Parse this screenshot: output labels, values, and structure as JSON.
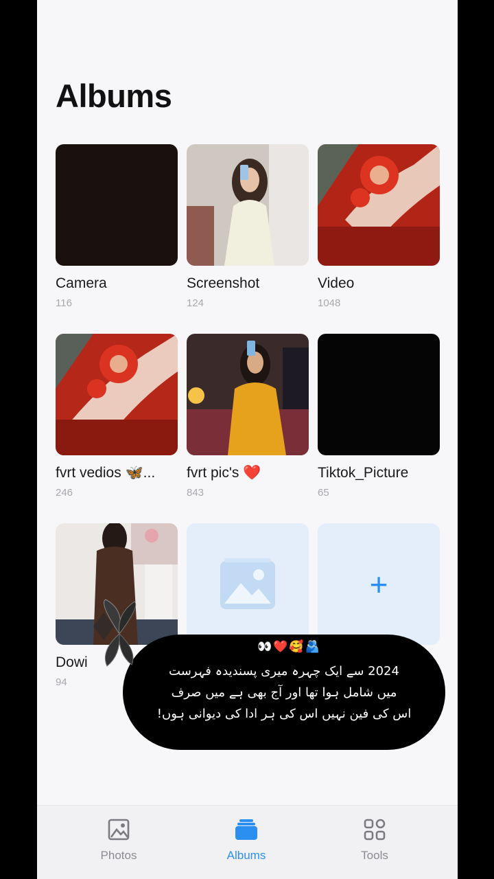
{
  "page": {
    "title": "Albums"
  },
  "albums": [
    {
      "name": "Camera",
      "count": "116",
      "thumb": "dark"
    },
    {
      "name": "Screenshot",
      "count": "124",
      "thumb": "photo-woman-white"
    },
    {
      "name": "Video",
      "count": "1048",
      "thumb": "photo-red-henna"
    },
    {
      "name": "fvrt vedios 🦋...",
      "count": "246",
      "thumb": "photo-red-henna"
    },
    {
      "name": "fvrt pic's ❤️",
      "count": "843",
      "thumb": "photo-woman-yellow"
    },
    {
      "name": "Tiktok_Picture",
      "count": "65",
      "thumb": "black"
    },
    {
      "name": "Dowi",
      "count": "94",
      "thumb": "photo-woman-brown"
    },
    {
      "name": "",
      "count": "",
      "thumb": "placeholder-image-icon"
    },
    {
      "name": "",
      "count": "",
      "thumb": "add-icon"
    }
  ],
  "add_album": {
    "symbol": "+"
  },
  "overlay": {
    "emoji": "👀❤️🥰🫂",
    "lines": [
      "2024 سے ایک چہرہ میری پسندیدہ فہرست",
      "میں شامل ہوا تھا اور آج بھی ہے میں صرف",
      "اس کی فین نہیں اس کی ہر ادا کی دیوانی ہوں!"
    ]
  },
  "bottom_nav": {
    "items": [
      {
        "label": "Photos",
        "icon": "photos-icon",
        "active": false
      },
      {
        "label": "Albums",
        "icon": "albums-icon",
        "active": true
      },
      {
        "label": "Tools",
        "icon": "tools-icon",
        "active": false
      }
    ]
  },
  "colors": {
    "accent": "#2a8ff0",
    "background": "#f7f7f9"
  }
}
